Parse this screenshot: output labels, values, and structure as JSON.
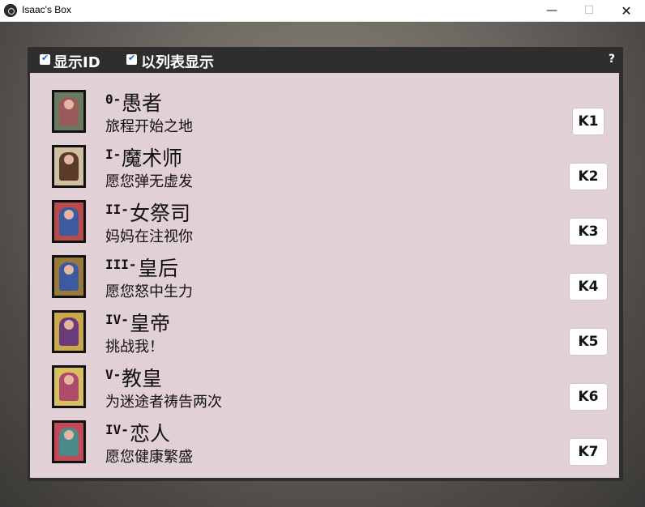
{
  "window": {
    "title": "Isaac's Box",
    "minimize_glyph": "—",
    "maximize_glyph": "☐",
    "close_glyph": "✕"
  },
  "toolbar": {
    "show_id_label": "显示ID",
    "show_id_checked": true,
    "list_view_label": "以列表显示",
    "list_view_checked": true,
    "help_label": "?"
  },
  "cards": [
    {
      "roman": "0-",
      "name": "愚者",
      "desc": "旅程开始之地",
      "key": "K1",
      "card_color": "#6a7a60",
      "accent": "#9a5a5a"
    },
    {
      "roman": "I-",
      "name": "魔术师",
      "desc": "愿您弹无虚发",
      "key": "K2",
      "card_color": "#cfc1a0",
      "accent": "#5a3b2a"
    },
    {
      "roman": "II-",
      "name": "女祭司",
      "desc": "妈妈在注视你",
      "key": "K3",
      "card_color": "#b84b4b",
      "accent": "#3b5aa0"
    },
    {
      "roman": "III-",
      "name": "皇后",
      "desc": "愿您怒中生力",
      "key": "K4",
      "card_color": "#9a7a3a",
      "accent": "#3b5aa0"
    },
    {
      "roman": "IV-",
      "name": "皇帝",
      "desc": "挑战我！",
      "key": "K5",
      "card_color": "#c9a84a",
      "accent": "#6a3a7a"
    },
    {
      "roman": "V-",
      "name": "教皇",
      "desc": "为迷途者祷告两次",
      "key": "K6",
      "card_color": "#d8c060",
      "accent": "#b04a6a"
    },
    {
      "roman": "IV-",
      "name": "恋人",
      "desc": "愿您健康繁盛",
      "key": "K7",
      "card_color": "#c44a5a",
      "accent": "#4a8a8a"
    }
  ]
}
